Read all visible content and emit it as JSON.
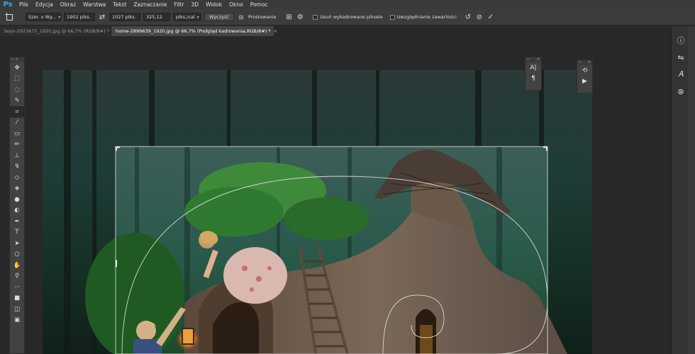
{
  "app": {
    "logo": "Ps"
  },
  "menu": [
    "Plik",
    "Edycja",
    "Obraz",
    "Warstwa",
    "Tekst",
    "Zaznaczanie",
    "Filtr",
    "3D",
    "Widok",
    "Okno",
    "Pomoc"
  ],
  "options": {
    "ratio_select": "Szer. x Wy...",
    "width_value": "1902 piks.",
    "swap_icon": "swap-icon",
    "height_value": "1027 piks.",
    "resolution_value": "325,12",
    "resolution_unit": "piks./cal",
    "clear_label": "Wyczyść",
    "straighten_label": "Prostowanie",
    "delete_cropped_label": "Usuń wykadrowane piksele",
    "content_aware_label": "Uwzględnianie zawartości"
  },
  "tabs": [
    {
      "label": "boys-2923675_1920.jpg @ 66,7% (RGB/8#) *",
      "close": "×"
    },
    {
      "label": "home-2899639_1920.jpg @ 66,7% (Podgląd kadrowania,RGB/8#) *",
      "close": "×"
    }
  ],
  "toolbar": {
    "tools": [
      "move-tool-icon",
      "marquee-tool-icon",
      "lasso-tool-icon",
      "quick-select-tool-icon",
      "crop-tool-icon",
      "eyedropper-tool-icon",
      "healing-tool-icon",
      "brush-tool-icon",
      "clone-stamp-tool-icon",
      "history-brush-tool-icon",
      "eraser-tool-icon",
      "paint-bucket-tool-icon",
      "blur-tool-icon",
      "dodge-tool-icon",
      "pen-tool-icon",
      "type-tool-icon",
      "path-select-tool-icon",
      "ellipse-tool-icon",
      "hand-tool-icon",
      "zoom-tool-icon",
      "more-tools-icon",
      "color-swatch-icon",
      "quick-mask-icon",
      "screen-mode-icon"
    ]
  },
  "panels": {
    "char_panel": [
      "A|",
      "¶"
    ],
    "actions_panel": [
      "history-icon",
      "play-icon"
    ]
  },
  "colors": {
    "accent": "#31a8ff",
    "ui_bg": "#282828",
    "panel_bg": "#424242"
  }
}
